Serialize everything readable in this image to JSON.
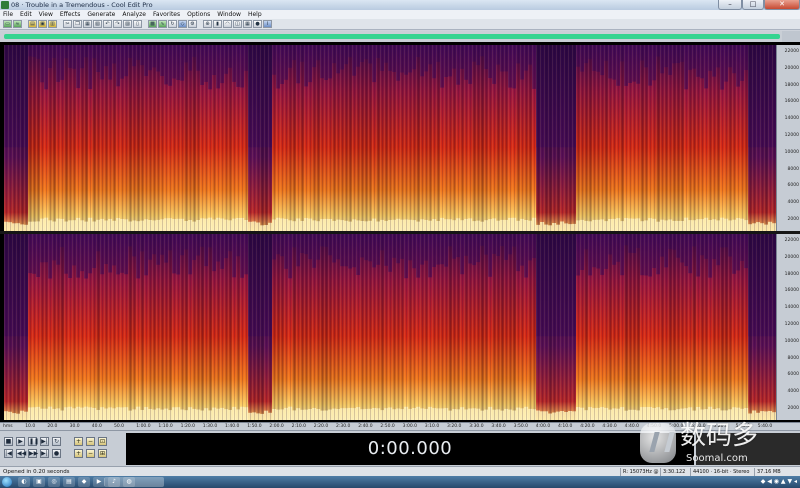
{
  "window": {
    "title": "08 · Trouble in a Tremendous - Cool Edit Pro",
    "minimize": "–",
    "maximize": "□",
    "close": "✕"
  },
  "menu": [
    "File",
    "Edit",
    "View",
    "Effects",
    "Generate",
    "Analyze",
    "Favorites",
    "Options",
    "Window",
    "Help"
  ],
  "toolbar": {
    "buttons": [
      {
        "icon": "mode-icon",
        "glyph": "▭",
        "style": "green"
      },
      {
        "icon": "waveform-icon",
        "glyph": "≈",
        "style": "green"
      },
      {
        "icon": "open-icon",
        "glyph": "▤",
        "style": "yellow"
      },
      {
        "icon": "save-icon",
        "glyph": "▣",
        "style": "yellow"
      },
      {
        "icon": "folder-icon",
        "glyph": "▥",
        "style": "yellow"
      },
      {
        "icon": "cut-icon",
        "glyph": "✂",
        "style": ""
      },
      {
        "icon": "copy-icon",
        "glyph": "❐",
        "style": ""
      },
      {
        "icon": "paste-icon",
        "glyph": "▦",
        "style": ""
      },
      {
        "icon": "mix-paste-icon",
        "glyph": "▧",
        "style": ""
      },
      {
        "icon": "undo-icon",
        "glyph": "↶",
        "style": ""
      },
      {
        "icon": "redo-icon",
        "glyph": "↷",
        "style": ""
      },
      {
        "icon": "trim-icon",
        "glyph": "▨",
        "style": ""
      },
      {
        "icon": "silence-icon",
        "glyph": "▯",
        "style": ""
      },
      {
        "icon": "spectral-view-icon",
        "glyph": "▩",
        "style": "green"
      },
      {
        "icon": "wave-view-icon",
        "glyph": "∿",
        "style": "green"
      },
      {
        "icon": "loop-icon",
        "glyph": "↻",
        "style": ""
      },
      {
        "icon": "cue-icon",
        "glyph": "◇",
        "style": "blue"
      },
      {
        "icon": "settings-icon",
        "glyph": "⚙",
        "style": ""
      },
      {
        "icon": "zoom-icon",
        "glyph": "⊕",
        "style": ""
      },
      {
        "icon": "mark-icon",
        "glyph": "▮",
        "style": ""
      },
      {
        "icon": "envelope-icon",
        "glyph": "◠",
        "style": ""
      },
      {
        "icon": "filter-icon",
        "glyph": "◫",
        "style": ""
      },
      {
        "icon": "noise-icon",
        "glyph": "▦",
        "style": ""
      },
      {
        "icon": "record-icon",
        "glyph": "●",
        "style": ""
      },
      {
        "icon": "info-icon",
        "glyph": "i",
        "style": "blue"
      }
    ]
  },
  "rulers": {
    "frequency_labels": [
      "22000",
      "20000",
      "18000",
      "16000",
      "14000",
      "12000",
      "10000",
      "8000",
      "6000",
      "4000",
      "2000"
    ],
    "time_labels": [
      "hms",
      "10.0",
      "20.0",
      "30.0",
      "40.0",
      "50.0",
      "1:00.0",
      "1:10.0",
      "1:20.0",
      "1:30.0",
      "1:40.0",
      "1:50.0",
      "2:00.0",
      "2:10.0",
      "2:20.0",
      "2:30.0",
      "2:40.0",
      "2:50.0",
      "3:00.0",
      "3:10.0",
      "3:20.0",
      "3:30.0",
      "3:40.0",
      "3:50.0",
      "4:00.0",
      "4:10.0",
      "4:20.0",
      "4:30.0",
      "4:40.0",
      "4:50.0",
      "5:00.0",
      "5:10.0",
      "5:20.0",
      "5:30.0",
      "5:40.0"
    ]
  },
  "transport": {
    "buttons": [
      {
        "icon": "stop-icon",
        "glyph": "■"
      },
      {
        "icon": "play-icon",
        "glyph": "▶"
      },
      {
        "icon": "pause-icon",
        "glyph": "❚❚"
      },
      {
        "icon": "play-to-end-icon",
        "glyph": "▶|"
      },
      {
        "icon": "loop-play-icon",
        "glyph": "↻"
      },
      {
        "icon": "go-start-icon",
        "glyph": "|◀"
      },
      {
        "icon": "rewind-icon",
        "glyph": "◀◀"
      },
      {
        "icon": "fast-forward-icon",
        "glyph": "▶▶"
      },
      {
        "icon": "go-end-icon",
        "glyph": "▶|"
      },
      {
        "icon": "record-icon",
        "glyph": "●"
      }
    ],
    "zoom": [
      {
        "icon": "zoom-in-horizontal-icon",
        "glyph": "+"
      },
      {
        "icon": "zoom-out-horizontal-icon",
        "glyph": "−"
      },
      {
        "icon": "zoom-full-icon",
        "glyph": "⊡"
      },
      {
        "icon": "zoom-in-vertical-icon",
        "glyph": "+"
      },
      {
        "icon": "zoom-out-vertical-icon",
        "glyph": "−"
      },
      {
        "icon": "zoom-selection-icon",
        "glyph": "⊞"
      }
    ],
    "time": "0:00.000"
  },
  "status": {
    "message": "Opened in 0.20 seconds",
    "cells": [
      "R: 15073Hz @",
      "3:30.122",
      "44100 · 16-bit · Stereo",
      "37.16 MB"
    ]
  },
  "watermark": {
    "cn": "数码多",
    "en": "Soomal.com"
  },
  "taskbar": {
    "tasks": [
      "◐",
      "▣",
      "◎",
      "▤",
      "◆",
      "▶",
      "♪",
      "◍"
    ],
    "tray": "◆ ◀ ◉ ▲ ▼ ◂"
  },
  "colors": {
    "spectrum_high": "#ffe9a8",
    "spectrum_mid": "#e03a14",
    "spectrum_low": "#3a0a55",
    "overview": "#34d48f"
  }
}
